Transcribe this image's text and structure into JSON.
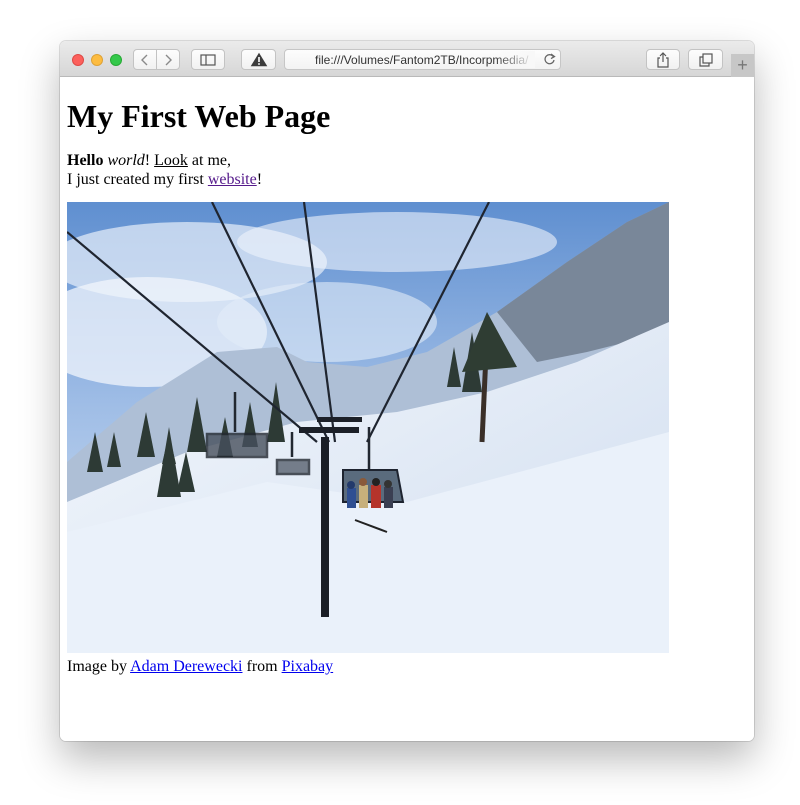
{
  "browser": {
    "url": "file:///Volumes/Fantom2TB/Incorpmedia/",
    "new_tab_label": "+"
  },
  "page": {
    "heading": "My First Web Page",
    "line1": {
      "bold": "Hello",
      "space1": " ",
      "italic": "world",
      "bang1": "! ",
      "underlined": "Look",
      "rest": " at me,"
    },
    "line2": {
      "prefix": "I just created my first ",
      "link": "website",
      "suffix": "!"
    },
    "credit": {
      "prefix": "Image by ",
      "author": "Adam Derewecki",
      "middle": " from ",
      "source": "Pixabay"
    }
  },
  "colors": {
    "link": "#0000ee",
    "visited_link": "#551a8b",
    "traffic_red": "#fc605c",
    "traffic_yellow": "#fdbc40",
    "traffic_green": "#34c84a"
  }
}
